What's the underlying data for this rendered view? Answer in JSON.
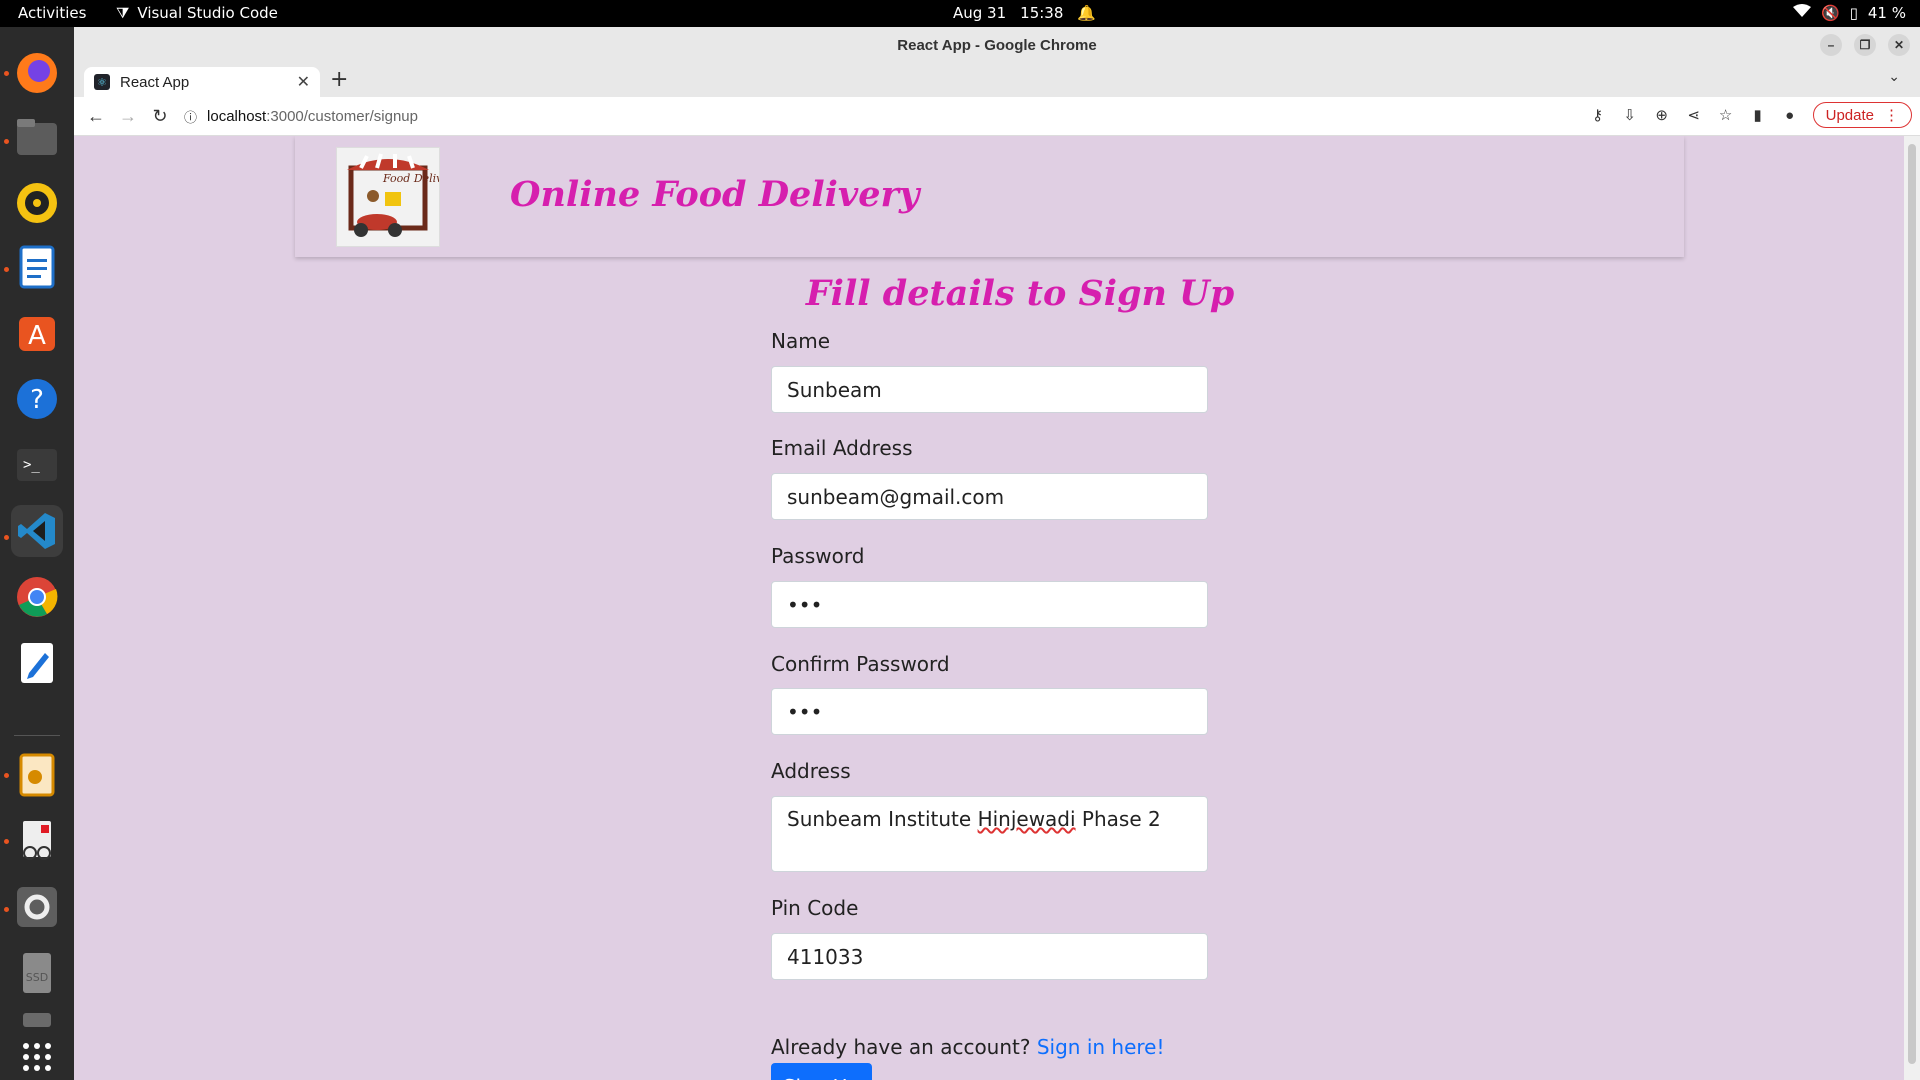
{
  "system": {
    "activities": "Activities",
    "app_name": "Visual Studio Code",
    "date": "Aug 31",
    "time": "15:38",
    "battery": "41 %"
  },
  "browser": {
    "window_title": "React App - Google Chrome",
    "tab_title": "React App",
    "url_host": "localhost",
    "url_path": ":3000/customer/signup",
    "update_label": "Update"
  },
  "header": {
    "title": "Online Food Delivery",
    "logo_text": "Food Delivery"
  },
  "form": {
    "title": "Fill details to Sign Up",
    "fields": [
      {
        "label": "Name",
        "value": "Sunbeam"
      },
      {
        "label": "Email Address",
        "value": "sunbeam@gmail.com"
      },
      {
        "label": "Password",
        "value": "•••"
      },
      {
        "label": "Confirm Password",
        "value": "•••"
      },
      {
        "label": "Address",
        "value_a": "Sunbeam Institute ",
        "value_b": "Hinjewadi",
        "value_c": " Phase 2"
      },
      {
        "label": "Pin Code",
        "value": "411033"
      }
    ],
    "signin_prompt": "Already have an account?",
    "signin_link": "Sign in here!",
    "submit_label": "Sign Up"
  },
  "colors": {
    "page_bg": "#e0cfe3",
    "title_magenta": "#d61fae",
    "primary_blue": "#0d6efd"
  }
}
